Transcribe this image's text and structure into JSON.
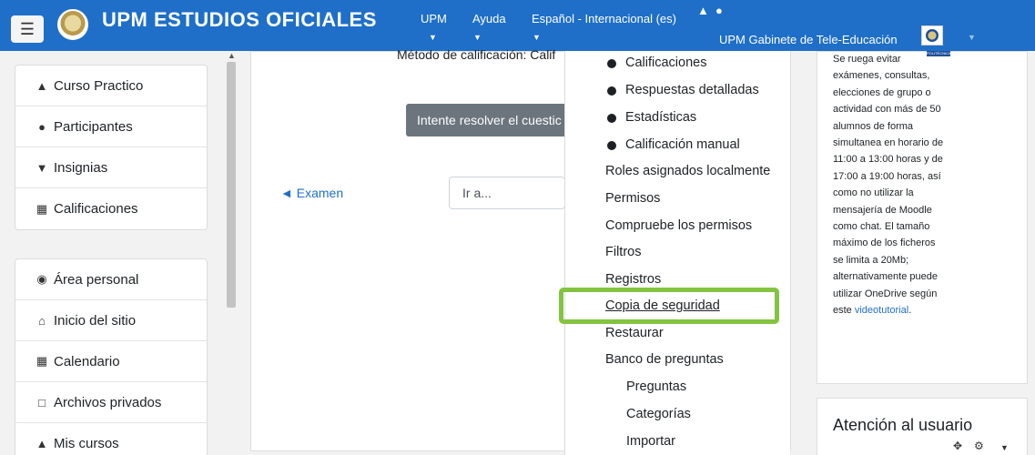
{
  "header": {
    "site_title": "UPM ESTUDIOS OFICIALES",
    "links": [
      "UPM",
      "Ayuda",
      "Español - Internacional (es)"
    ],
    "user_name": "UPM Gabinete de Tele-Educación",
    "icons": [
      "menu-icon",
      "bell-icon",
      "comment-icon",
      "caret-down-icon"
    ]
  },
  "sidebar": {
    "course_items": [
      {
        "label": "Curso Practico",
        "icon": "graduation-cap-icon"
      },
      {
        "label": "Participantes",
        "icon": "users-icon"
      },
      {
        "label": "Insignias",
        "icon": "shield-icon"
      },
      {
        "label": "Calificaciones",
        "icon": "table-icon"
      }
    ],
    "site_items": [
      {
        "label": "Área personal",
        "icon": "dashboard-icon"
      },
      {
        "label": "Inicio del sitio",
        "icon": "home-icon"
      },
      {
        "label": "Calendario",
        "icon": "calendar-icon"
      },
      {
        "label": "Archivos privados",
        "icon": "file-icon"
      },
      {
        "label": "Mis cursos",
        "icon": "graduation-cap-icon"
      }
    ]
  },
  "main": {
    "grading_method": "Método de calificación: Calif",
    "attempt_button": "Intente resolver el cuestic",
    "prev_link": "◄ Examen",
    "goto_select": "Ir a..."
  },
  "dropdown": {
    "items": [
      "Calificaciones",
      "Respuestas detalladas",
      "Estadísticas",
      "Calificación manual",
      "Roles asignados localmente",
      "Permisos",
      "Compruebe los permisos",
      "Filtros",
      "Registros",
      "Copia de seguridad",
      "Restaurar",
      "Banco de preguntas",
      "Preguntas",
      "Categorías",
      "Importar"
    ],
    "highlight_color": "#84c341"
  },
  "notice": {
    "lines": [
      "Se ruega evitar",
      "exámenes, consultas,",
      "elecciones de grupo o",
      "actividad con más de 50",
      "alumnos de forma",
      "simultanea en horario de",
      "11:00 a 13:00 horas y de",
      "17:00 a 19:00 horas, así",
      "como no utilizar la",
      "mensajería de Moodle",
      "como chat. El tamaño",
      "máximo de los ficheros",
      "se limita a 20Mb;",
      "alternativamente puede",
      "utilizar OneDrive según"
    ],
    "last_prefix": "este ",
    "link": "videotutorial",
    "last_suffix": ".",
    "logo_text": "POLITÉCNICA"
  },
  "support": {
    "title": "Atención al usuario"
  },
  "colors": {
    "brand": "#1f6fc8",
    "button_gray": "#6c757d"
  }
}
